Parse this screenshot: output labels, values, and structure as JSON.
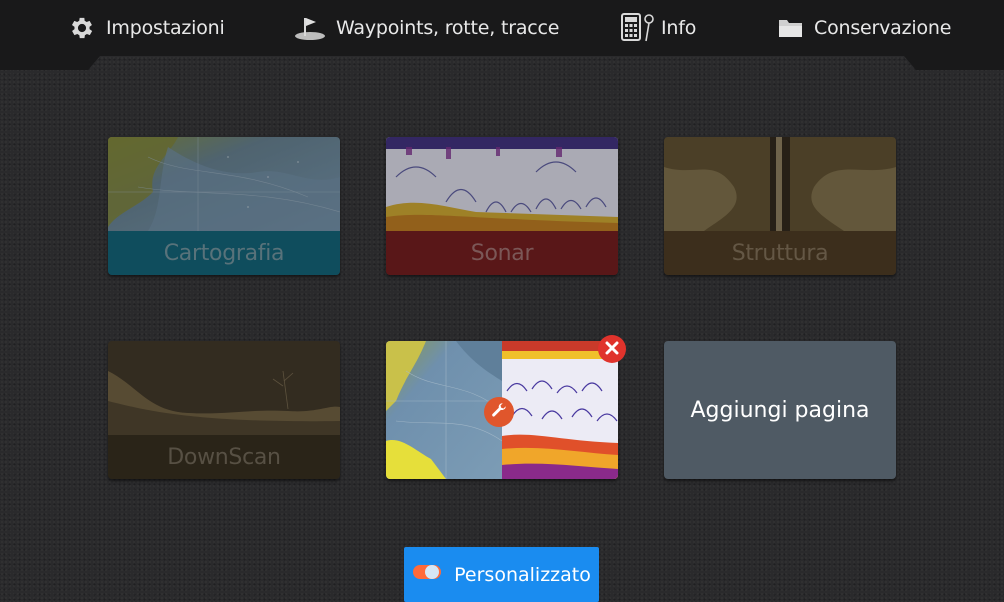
{
  "menu": {
    "items": [
      {
        "label": "Impostazioni",
        "icon": "gear-icon"
      },
      {
        "label": "Waypoints, rotte, tracce",
        "icon": "waypoint-flag-icon"
      },
      {
        "label": "Info",
        "icon": "calculator-info-icon"
      },
      {
        "label": "Conservazione",
        "icon": "folder-icon"
      }
    ]
  },
  "tiles": [
    {
      "label": "Cartografia",
      "band_color": "#0a5d72",
      "text_color": "#6b8e98"
    },
    {
      "label": "Sonar",
      "band_color": "#6d1516",
      "text_color": "#9a6a6a"
    },
    {
      "label": "Struttura",
      "band_color": "#46331b",
      "text_color": "#7b6a52"
    },
    {
      "label": "DownScan",
      "band_color": "#2e2616",
      "text_color": "#6a6150"
    }
  ],
  "combo_tile": {
    "left_view": "chart",
    "right_view": "sonar",
    "close_icon": "close-icon",
    "edit_icon": "wrench-icon"
  },
  "add_page": {
    "label": "Aggiungi pagina"
  },
  "custom_button": {
    "label": "Personalizzato",
    "icon": "toggle-icon"
  },
  "colors": {
    "accent": "#1a8cf0",
    "close_badge": "#e0332c",
    "edit_badge": "#e0562c"
  }
}
